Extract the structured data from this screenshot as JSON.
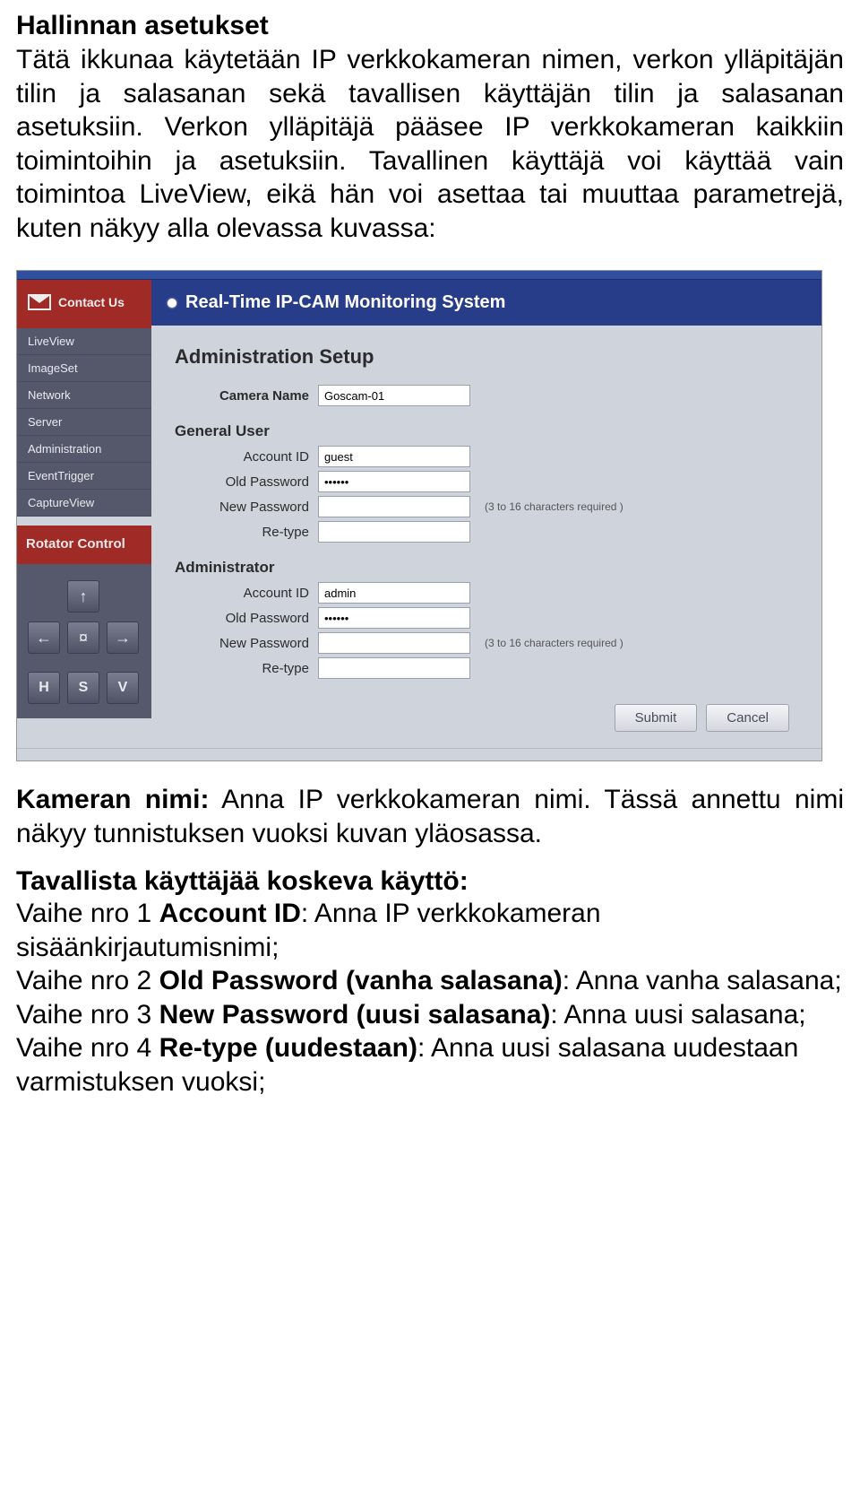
{
  "doc": {
    "heading": "Hallinnan asetukset",
    "para1": "Tätä ikkunaa käytetään IP verkkokameran nimen, verkon ylläpitäjän tilin ja salasanan sekä tavallisen käyttäjän tilin ja salasanan asetuksiin. Verkon ylläpitäjä pääsee IP verkkokameran kaikkiin toimintoihin ja asetuksiin. Tavallinen käyttäjä voi käyttää vain toimintoa LiveView, eikä hän voi asettaa tai muuttaa parametrejä, kuten näkyy alla olevassa kuvassa:",
    "camera_label": "Kameran nimi:",
    "camera_text": " Anna IP verkkokameran nimi. Tässä annettu nimi näkyy tunnistuksen vuoksi kuvan yläosassa.",
    "usage_heading": "Tavallista käyttäjää koskeva käyttö:",
    "step1_a": "Vaihe nro 1 ",
    "step1_b": "Account ID",
    "step1_c": ": Anna IP verkkokameran sisäänkirjautumisnimi;",
    "step2_a": "Vaihe nro 2 ",
    "step2_b": "Old Password (vanha salasana)",
    "step2_c": ": Anna vanha salasana;",
    "step3_a": "Vaihe nro 3 ",
    "step3_b": "New Password (uusi salasana)",
    "step3_c": ": Anna uusi salasana;",
    "step4_a": "Vaihe nro 4 ",
    "step4_b": "Re-type (uudestaan)",
    "step4_c": ": Anna uusi salasana uudestaan varmistuksen vuoksi;"
  },
  "ui": {
    "systemTitle": "Real-Time IP-CAM Monitoring System",
    "contact": "Contact Us",
    "nav": [
      "LiveView",
      "ImageSet",
      "Network",
      "Server",
      "Administration",
      "EventTrigger",
      "CaptureView"
    ],
    "rotator": "Rotator Control",
    "arrows": {
      "up": "↑",
      "left": "←",
      "center": "¤",
      "right": "→",
      "down": ""
    },
    "hsv": [
      "H",
      "S",
      "V"
    ],
    "pageTitle": "Administration Setup",
    "cameraNameLabel": "Camera Name",
    "cameraNameValue": "Goscam-01",
    "generalUser": "General User",
    "administrator": "Administrator",
    "accountId": "Account ID",
    "oldPassword": "Old Password",
    "newPassword": "New Password",
    "retype": "Re-type",
    "gu": {
      "account": "guest",
      "old": "••••••",
      "new": "",
      "retype": ""
    },
    "ad": {
      "account": "admin",
      "old": "••••••",
      "new": "",
      "retype": ""
    },
    "hint": "(3 to 16 characters required )",
    "submit": "Submit",
    "cancel": "Cancel"
  }
}
